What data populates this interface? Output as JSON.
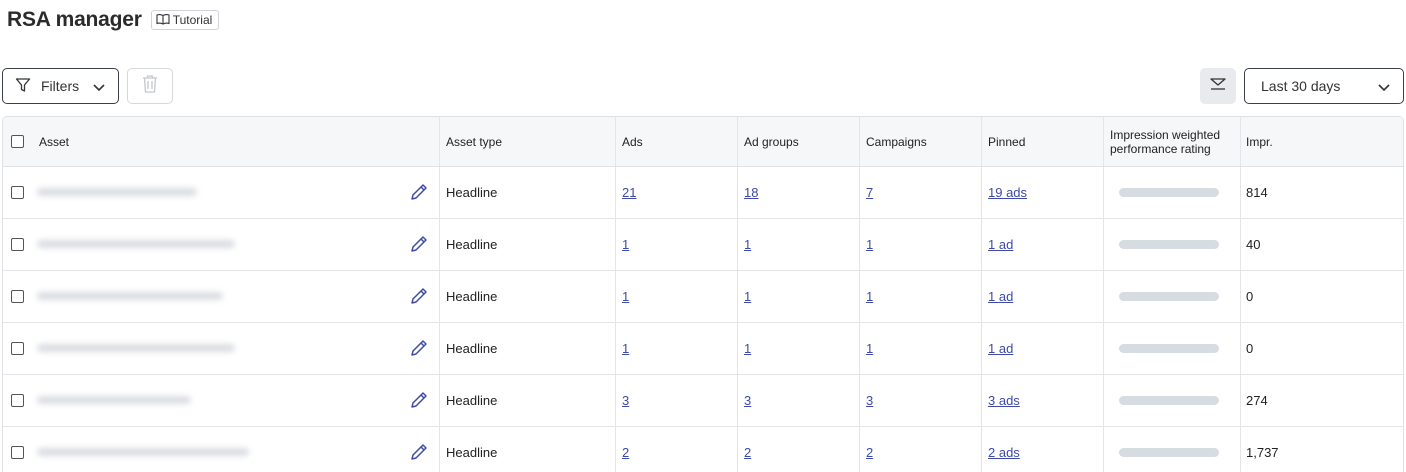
{
  "header": {
    "title": "RSA manager",
    "tutorial_label": "Tutorial"
  },
  "toolbar": {
    "filters_label": "Filters",
    "date_range": "Last 30 days"
  },
  "table": {
    "columns": {
      "asset": "Asset",
      "asset_type": "Asset type",
      "ads": "Ads",
      "ad_groups": "Ad groups",
      "campaigns": "Campaigns",
      "pinned": "Pinned",
      "rating": "Impression weighted performance rating",
      "impr": "Impr."
    },
    "rows": [
      {
        "type": "Headline",
        "ads": "21",
        "ad_groups": "18",
        "campaigns": "7",
        "pinned": "19 ads",
        "impr": "814"
      },
      {
        "type": "Headline",
        "ads": "1",
        "ad_groups": "1",
        "campaigns": "1",
        "pinned": "1 ad",
        "impr": "40"
      },
      {
        "type": "Headline",
        "ads": "1",
        "ad_groups": "1",
        "campaigns": "1",
        "pinned": "1 ad",
        "impr": "0"
      },
      {
        "type": "Headline",
        "ads": "1",
        "ad_groups": "1",
        "campaigns": "1",
        "pinned": "1 ad",
        "impr": "0"
      },
      {
        "type": "Headline",
        "ads": "3",
        "ad_groups": "3",
        "campaigns": "3",
        "pinned": "3 ads",
        "impr": "274"
      },
      {
        "type": "Headline",
        "ads": "2",
        "ad_groups": "2",
        "campaigns": "2",
        "pinned": "2 ads",
        "impr": "1,737"
      }
    ]
  },
  "icons": {
    "tutorial": "book-icon",
    "filters": "filter-funnel-icon",
    "delete": "trash-icon",
    "collapse": "collapse-panel-icon",
    "edit": "pencil-icon",
    "dropdown": "chevron-down-icon"
  },
  "colors": {
    "link": "#3d4aa8",
    "header_bg": "#f6f7f9",
    "rating_bar": "#d7dce3"
  }
}
